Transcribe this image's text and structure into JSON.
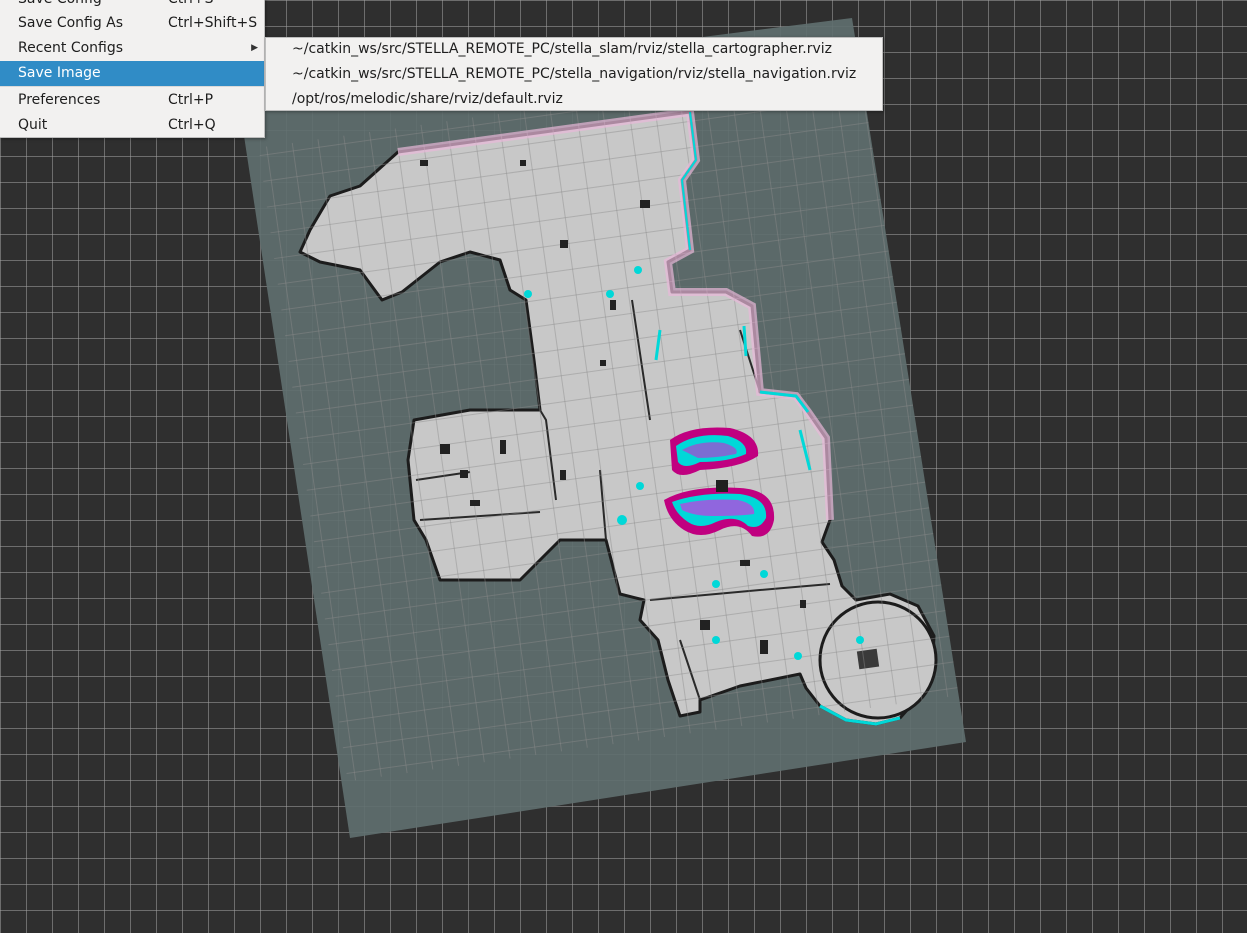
{
  "menu": {
    "items": [
      {
        "label": "Save Config",
        "shortcut": "Ctrl+S"
      },
      {
        "label": "Save Config As",
        "shortcut": "Ctrl+Shift+S"
      },
      {
        "label": "Recent Configs",
        "shortcut": ""
      },
      {
        "label": "Save Image",
        "shortcut": ""
      },
      {
        "label": "Preferences",
        "shortcut": "Ctrl+P"
      },
      {
        "label": "Quit",
        "shortcut": "Ctrl+Q"
      }
    ],
    "active_item": "Save Image",
    "highlight_color": "#308cc6",
    "submenu_arrow_icon": "chevron-right-icon"
  },
  "recent_configs": [
    "~/catkin_ws/src/STELLA_REMOTE_PC/stella_slam/rviz/stella_cartographer.rviz",
    "~/catkin_ws/src/STELLA_REMOTE_PC/stella_navigation/rviz/stella_navigation.rviz",
    "/opt/ros/melodic/share/rviz/default.rviz"
  ],
  "viewport": {
    "background_color": "#2f2f2f",
    "grid_color": "#a0a0a0",
    "costmap_color": "#5f6f6f",
    "free_space_color": "#c8c8c8",
    "inflation_colors": [
      "#e8b8d8",
      "#00d8d8",
      "#c00080",
      "#ff00ff"
    ]
  }
}
